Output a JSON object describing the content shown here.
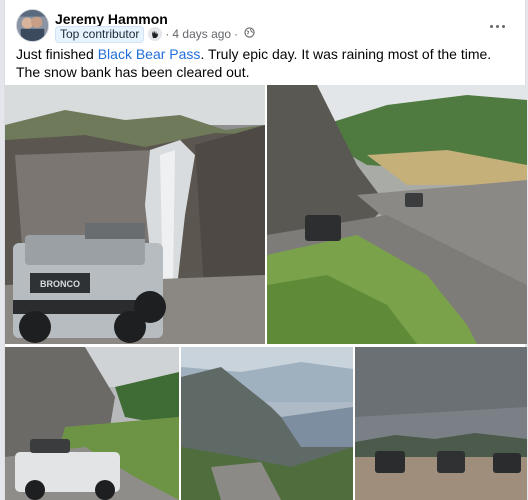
{
  "post": {
    "author": "Jeremy Hammon",
    "badge": "Top contributor",
    "time": "4 days ago",
    "separator": "·",
    "text_before": "Just finished ",
    "link_text": "Black Bear Pass",
    "text_after": ". Truly epic day. It was raining most of the time. The snow bank has been cleared out."
  },
  "icons": {
    "more": "more-horizontal-icon",
    "globe": "globe-icon",
    "badge": "waving-hand-icon"
  },
  "colors": {
    "link": "#216fdb",
    "badge_bg": "#e7f3ff",
    "meta": "#65676b"
  },
  "photos": [
    {
      "name": "waterfall-jeep-photo"
    },
    {
      "name": "mountain-trail-photo"
    },
    {
      "name": "cliff-bronco-photo"
    },
    {
      "name": "valley-view-photo"
    },
    {
      "name": "three-vehicles-photo"
    }
  ]
}
